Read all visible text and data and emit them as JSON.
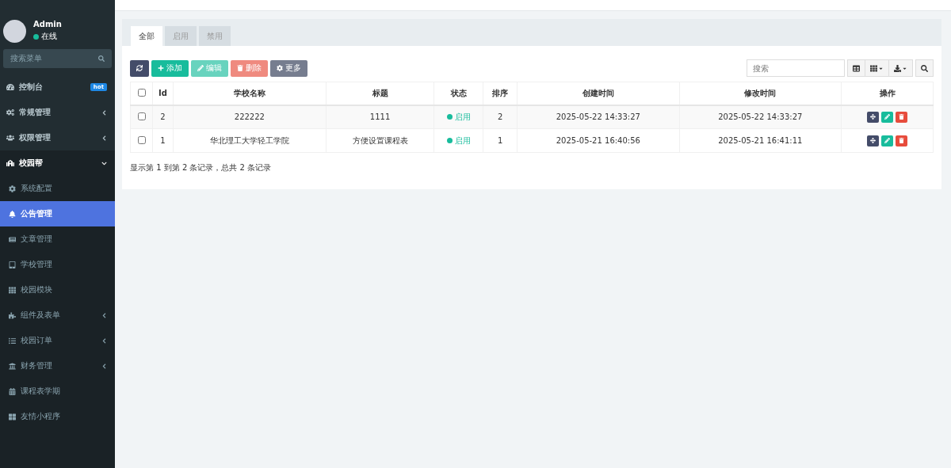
{
  "user": {
    "name": "Admin",
    "status": "在线",
    "online": true
  },
  "sidebar": {
    "search_placeholder": "搜索菜单",
    "items": [
      {
        "label": "控制台",
        "badge": "hot",
        "selected": false
      },
      {
        "label": "常规管理",
        "expanded": false,
        "selected": false
      },
      {
        "label": "权限管理",
        "expanded": false,
        "selected": false
      },
      {
        "label": "校园帮",
        "expanded": true,
        "selected": false,
        "children": [
          {
            "label": "系统配置",
            "selected": false
          },
          {
            "label": "公告管理",
            "selected": true
          },
          {
            "label": "文章管理",
            "selected": false
          },
          {
            "label": "学校管理",
            "selected": false
          },
          {
            "label": "校园模块",
            "selected": false
          },
          {
            "label": "组件及表单",
            "expanded": false,
            "selected": false
          },
          {
            "label": "校园订单",
            "expanded": false,
            "selected": false
          },
          {
            "label": "财务管理",
            "expanded": false,
            "selected": false
          },
          {
            "label": "课程表学期",
            "selected": false
          },
          {
            "label": "友情小程序",
            "selected": false
          }
        ]
      }
    ]
  },
  "tabs": [
    {
      "label": "全部",
      "selected": true
    },
    {
      "label": "启用",
      "selected": false
    },
    {
      "label": "禁用",
      "selected": false
    }
  ],
  "toolbar": {
    "buttons": [
      {
        "kind": "refresh",
        "disabled": false
      },
      {
        "kind": "add",
        "label": "添加",
        "disabled": false
      },
      {
        "kind": "edit",
        "label": "编辑",
        "disabled": true
      },
      {
        "kind": "delete",
        "label": "删除",
        "disabled": true
      },
      {
        "kind": "more",
        "label": "更多",
        "disabled": false
      }
    ],
    "search_placeholder": "搜索"
  },
  "table": {
    "all_checked": false,
    "columns": [
      "Id",
      "学校名称",
      "标题",
      "状态",
      "排序",
      "创建时间",
      "修改时间",
      "操作"
    ],
    "rows": [
      {
        "checked": false,
        "id": "2",
        "school": "222222",
        "title": "1111",
        "status": "启用",
        "order": "2",
        "created": "2025-05-22 14:33:27",
        "modified": "2025-05-22 14:33:27"
      },
      {
        "checked": false,
        "id": "1",
        "school": "华北理工大学轻工学院",
        "title": "方便设置课程表",
        "status": "启用",
        "order": "1",
        "created": "2025-05-21 16:40:56",
        "modified": "2025-05-21 16:41:11"
      }
    ]
  },
  "pagination_info": "显示第 1 到第 2 条记录，总共 2 条记录"
}
